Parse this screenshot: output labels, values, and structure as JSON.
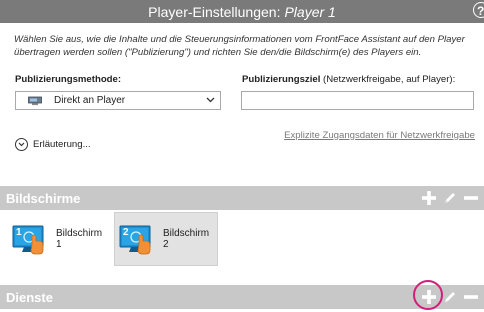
{
  "window": {
    "title_prefix": "Player-Einstellungen:",
    "title_player": "Player 1",
    "help_glyph": "?"
  },
  "intro_text": "Wählen Sie aus, wie die Inhalte und die Steuerungsinformationen vom FrontFace Assistant auf den Player übertragen werden sollen (\"Publizierung\") und richten Sie den/die Bildschirm(e) des Players ein.",
  "publishing": {
    "method_label": "Publizierungsmethode:",
    "method_value": "Direkt an Player",
    "target_label_bold": "Publizierungsziel",
    "target_label_rest": " (Netzwerkfreigabe, auf Player):",
    "target_value": ""
  },
  "explanation_label": "Erläuterung...",
  "credentials_link": "Explizite Zugangsdaten für Netzwerkfreigabe",
  "sections": {
    "screens_title": "Bildschirme",
    "services_title": "Dienste"
  },
  "screens": [
    {
      "number": "1",
      "label": "Bildschirm 1",
      "selected": false
    },
    {
      "number": "2",
      "label": "Bildschirm 2",
      "selected": true
    }
  ],
  "colors": {
    "titlebar": "#7a7a7a",
    "section_bar": "#c8c8c8",
    "monitor_blue": "#1e8fd0",
    "hand_orange": "#f0913a",
    "highlight": "#d21f7a"
  }
}
